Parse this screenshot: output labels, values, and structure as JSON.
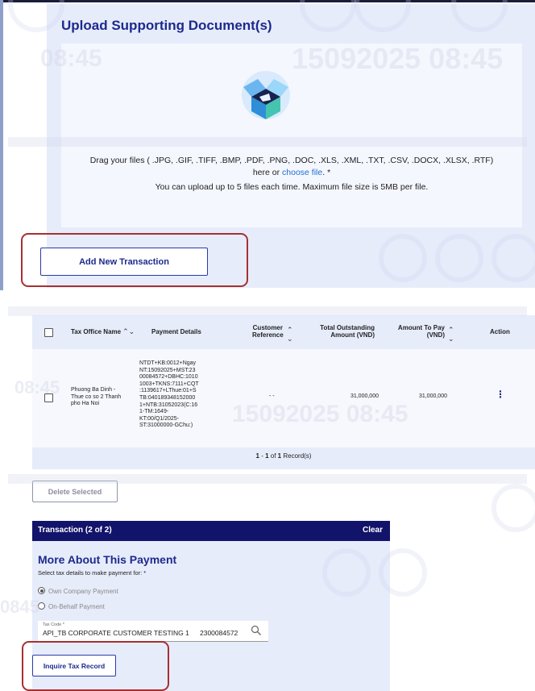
{
  "upload": {
    "title": "Upload Supporting Document(s)",
    "icon": "open-box-icon",
    "drag_prefix": "Drag your files ( .JPG, .GIF, .TIFF, .BMP, .PDF, .PNG, .DOC, .XLS, .XML, .TXT, .CSV, .DOCX, .XLSX, .RTF)",
    "drag_here_or": "here or",
    "choose_file_link": "choose file",
    "drag_suffix": ". *",
    "limit_text": "You can upload up to 5 files each time. Maximum file size is 5MB per file."
  },
  "add_transaction_label": "Add New Transaction",
  "table": {
    "headers": {
      "tax_office": "Tax Office Name",
      "payment_details": "Payment Details",
      "customer_reference_1": "Customer",
      "customer_reference_2": "Reference",
      "total_outstanding_1": "Total Outstanding",
      "total_outstanding_2": "Amount (VND)",
      "amount_to_pay_1": "Amount To Pay",
      "amount_to_pay_2": "(VND)",
      "action": "Action"
    },
    "rows": [
      {
        "tax_office_lines": [
          "Phuong Ba Dinh -",
          "Thue co so 2 Thanh",
          "pho Ha Noi"
        ],
        "payment_details_lines": [
          "NTDT+KB:0012+Ngay",
          "NT:15092025+MST:23",
          "00084572+DBHC:1010",
          "1003+TKNS:7111+CQT",
          ":1139617+LThue:01+S",
          "TB:040189348152000",
          "1+NTB:31052023(C:16",
          "1-TM:1649-",
          "KT:00/Q1/2025-",
          "ST:31000000-GChu:)"
        ],
        "customer_reference": "- -",
        "total_outstanding": "31,000,000",
        "amount_to_pay": "31,000,000"
      }
    ],
    "pager": {
      "range_start": "1",
      "dash": " - ",
      "range_end": "1",
      "of": " of ",
      "total": "1",
      "suffix": " Record(s)"
    }
  },
  "delete_selected_label": "Delete Selected",
  "transaction": {
    "header_title": "Transaction (2 of 2)",
    "clear_label": "Clear",
    "section_title": "More About This Payment",
    "select_label": "Select tax details to make payment for: *",
    "options": [
      "Own Company Payment",
      "On-Behalf Payment"
    ],
    "selected_option": "Own Company Payment",
    "tax_code_label": "Tax Code *",
    "tax_code_name": "API_TB CORPORATE CUSTOMER TESTING 1",
    "tax_code_number": "2300084572",
    "inquire_label": "Inquire Tax Record"
  },
  "watermark": {
    "timestamp": "15092025 08:45",
    "time_fragment": "08:45",
    "fragment_2": "08:45",
    "fragment_3": "0845"
  },
  "colors": {
    "primary_navy": "#12136a",
    "link_blue": "#1f6fd1",
    "panel_bg": "#e7ecfb",
    "highlight_red": "#a83030",
    "button_text": "#1d2a8c"
  }
}
